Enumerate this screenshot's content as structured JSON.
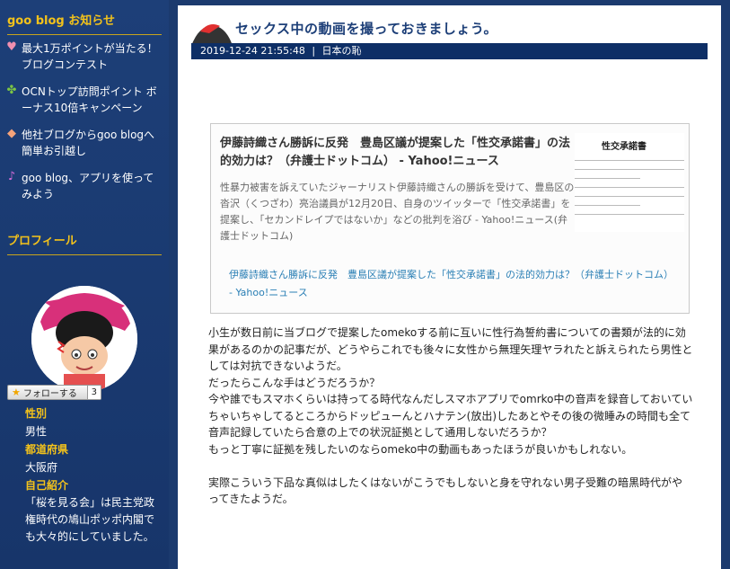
{
  "sidebar": {
    "notice_heading": "goo blog お知らせ",
    "notices": [
      {
        "icon": "heart-icon",
        "text": "最大1万ポイントが当たる！ブログコンテスト"
      },
      {
        "icon": "clover-icon",
        "text": "OCNトップ訪問ポイント ボーナス10倍キャンペーン"
      },
      {
        "icon": "heart-icon",
        "text": "他社ブログからgoo blogへ簡単お引越し"
      },
      {
        "icon": "music-note-icon",
        "text": "goo blog、アプリを使ってみよう"
      }
    ],
    "profile_heading": "プロフィール",
    "follow": {
      "label": "フォローする",
      "count": "3"
    },
    "profile": {
      "gender_label": "性別",
      "gender_value": "男性",
      "pref_label": "都道府県",
      "pref_value": "大阪府",
      "intro_label": "自己紹介",
      "intro_value": "「桜を見る会」は民主党政権時代の鳩山ポッポ内閣でも大々的にしていました。"
    }
  },
  "post": {
    "title": "セックス中の動画を撮っておきましょう。",
    "datetime": "2019-12-24 21:55:48",
    "category": "日本の恥",
    "card": {
      "title": "伊藤詩織さん勝訴に反発　豊島区議が提案した「性交承諾書」の法的効力は？（弁護士ドットコム） - Yahoo!ニュース",
      "description": "性暴力被害を訴えていたジャーナリスト伊藤詩織さんの勝訴を受けて、豊島区の沓沢（くつざわ）亮治議員が12月20日、自身のツイッターで「性交承諾書」を提案し、「セカンドレイプではないか」などの批判を浴び - Yahoo!ニュース(弁護士ドットコム)",
      "thumb_title": "性交承諾書",
      "link": "伊藤詩織さん勝訴に反発　豊島区議が提案した「性交承諾書」の法的効力は？（弁護士ドットコム） - Yahoo!ニュース"
    },
    "paragraphs": [
      "小生が数日前に当ブログで提案したomekoする前に互いに性行為誓約書についての書類が法的に効果があるのかの記事だが、どうやらこれでも後々に女性から無理矢理ヤラれたと訴えられたら男性としては対抗できないようだ。",
      "だったらこんな手はどうだろうか？",
      "今や誰でもスマホくらいは持ってる時代なんだしスマホアプリでomrko中の音声を録音しておいていちゃいちゃしてるところからドッピューんとハナテン(放出)したあとやその後の微睡みの時間も全て音声記録していたら合意の上での状況証拠として通用しないだろうか？",
      "もっと丁寧に証拠を残したいのならomeko中の動画もあったほうが良いかもしれない。",
      "",
      "実際こういう下品な真似はしたくはないがこうでもしないと身を守れない男子受難の暗黒時代がやってきたようだ。"
    ]
  }
}
